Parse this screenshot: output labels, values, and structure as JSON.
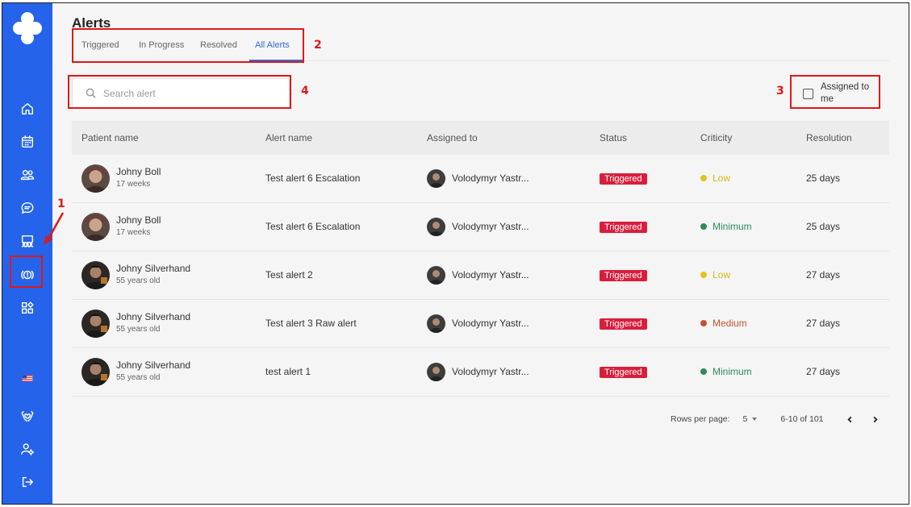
{
  "sidebar": {
    "nav": [
      {
        "name": "home-icon",
        "icon": "home"
      },
      {
        "name": "calendar-icon",
        "icon": "calendar"
      },
      {
        "name": "patients-icon",
        "icon": "users"
      },
      {
        "name": "chat-icon",
        "icon": "chat"
      },
      {
        "name": "team-icon",
        "icon": "team"
      },
      {
        "name": "alerts-icon",
        "icon": "alert"
      },
      {
        "name": "apps-icon",
        "icon": "apps"
      },
      {
        "name": "us-flag-icon",
        "icon": "flag"
      },
      {
        "name": "care-icon",
        "icon": "care"
      },
      {
        "name": "user-settings-icon",
        "icon": "user-settings"
      },
      {
        "name": "logout-icon",
        "icon": "logout"
      }
    ]
  },
  "page": {
    "title": "Alerts"
  },
  "tabs": [
    {
      "label": "Triggered",
      "active": false
    },
    {
      "label": "In Progress",
      "active": false
    },
    {
      "label": "Resolved",
      "active": false
    },
    {
      "label": "All Alerts",
      "active": true
    }
  ],
  "search": {
    "placeholder": "Search alert",
    "value": ""
  },
  "filter": {
    "assigned_to_me_label": "Assigned to me",
    "checked": false
  },
  "table": {
    "headers": [
      "Patient name",
      "Alert name",
      "Assigned to",
      "Status",
      "Criticity",
      "Resolution"
    ],
    "rows": [
      {
        "patient": "Johny Boll",
        "sub": "17 weeks",
        "alert": "Test alert 6 Escalation",
        "assigned": "Volodymyr Yastr...",
        "status": "Triggered",
        "criticity": "Low",
        "crit_color": "#e3c41a",
        "resolution": "25 days"
      },
      {
        "patient": "Johny Boll",
        "sub": "17 weeks",
        "alert": "Test alert 6 Escalation",
        "assigned": "Volodymyr Yastr...",
        "status": "Triggered",
        "criticity": "Minimum",
        "crit_color": "#2e8b57",
        "resolution": "25 days"
      },
      {
        "patient": "Johny Silverhand",
        "sub": "55 years old",
        "alert": "Test alert 2",
        "assigned": "Volodymyr Yastr...",
        "status": "Triggered",
        "criticity": "Low",
        "crit_color": "#e3c41a",
        "resolution": "27 days"
      },
      {
        "patient": "Johny Silverhand",
        "sub": "55 years old",
        "alert": "Test alert 3 Raw alert",
        "assigned": "Volodymyr Yastr...",
        "status": "Triggered",
        "criticity": "Medium",
        "crit_color": "#c4512c",
        "resolution": "27 days"
      },
      {
        "patient": "Johny Silverhand",
        "sub": "55 years old",
        "alert": "test alert 1",
        "assigned": "Volodymyr Yastr...",
        "status": "Triggered",
        "criticity": "Minimum",
        "crit_color": "#2e8b57",
        "resolution": "27 days"
      }
    ]
  },
  "pagination": {
    "rows_label": "Rows per page:",
    "rows_value": "5",
    "range": "6-10 of 101"
  },
  "annotations": {
    "n1": "1",
    "n2": "2",
    "n3": "3",
    "n4": "4"
  },
  "colors": {
    "sidebar": "#2563eb",
    "accent": "#2f6bdb",
    "badge": "#d91e3b",
    "annotation": "#e01818"
  }
}
